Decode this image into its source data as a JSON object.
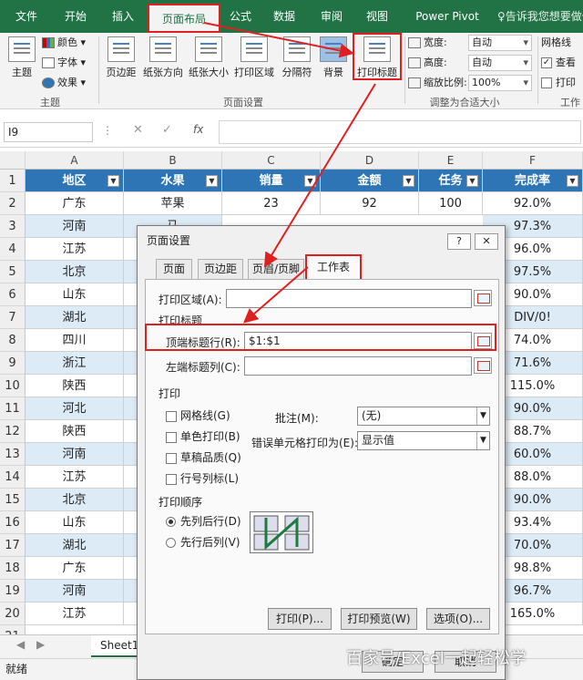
{
  "menu": {
    "tabs": [
      "文件",
      "开始",
      "插入",
      "页面布局",
      "公式",
      "数据",
      "审阅",
      "视图",
      "Power Pivot"
    ],
    "tellme": "告诉我您想要做什"
  },
  "ribbon": {
    "theme_group": {
      "label": "主题",
      "main": "主题",
      "colors": "颜色",
      "fonts": "字体",
      "effects": "效果"
    },
    "page_setup_group": {
      "label": "页面设置",
      "margins": "页边距",
      "orientation": "纸张方向",
      "size": "纸张大小",
      "print_area": "打印区域",
      "breaks": "分隔符",
      "background": "背景",
      "print_titles": "打印标题"
    },
    "scale_group": {
      "label": "调整为合适大小",
      "width_label": "宽度:",
      "width_value": "自动",
      "height_label": "高度:",
      "height_value": "自动",
      "scale_label": "缩放比例:",
      "scale_value": "100%"
    },
    "sheet_options": {
      "label": "网格线",
      "view": "查看",
      "print": "打印",
      "tab": "工作"
    }
  },
  "formula_bar": {
    "name_box": "I9",
    "fx": "fx"
  },
  "grid": {
    "columns": [
      "A",
      "B",
      "C",
      "D",
      "E",
      "F"
    ],
    "rows": [
      "1",
      "2",
      "3",
      "4",
      "5",
      "6",
      "7",
      "8",
      "9",
      "10",
      "11",
      "12",
      "13",
      "14",
      "15",
      "16",
      "17",
      "18",
      "19",
      "20",
      "21"
    ],
    "header": [
      "地区",
      "水果",
      "销量",
      "金额",
      "任务",
      "完成率"
    ],
    "first_row": [
      "广东",
      "苹果",
      "23",
      "92",
      "100",
      "92.0%"
    ],
    "col_a": [
      "河南",
      "江苏",
      "北京",
      "山东",
      "湖北",
      "四川",
      "浙江",
      "陕西",
      "河北",
      "陕西",
      "河南",
      "江苏",
      "北京",
      "山东",
      "湖北",
      "广东",
      "河南",
      "江苏"
    ],
    "col_b_partial": "马",
    "col_f_partial": [
      "97.3%",
      "96.0%",
      "97.5%",
      "90.0%",
      "DIV/0!",
      "74.0%",
      "71.6%",
      "115.0%",
      "90.0%",
      "88.7%",
      "60.0%",
      "88.0%",
      "90.0%",
      "93.4%",
      "70.0%",
      "98.8%",
      "96.7%",
      "165.0%"
    ]
  },
  "dialog": {
    "title": "页面设置",
    "help": "?",
    "close": "✕",
    "tabs": [
      "页面",
      "页边距",
      "页眉/页脚",
      "工作表"
    ],
    "print_area_label": "打印区域(A):",
    "print_titles_section": "打印标题",
    "rows_repeat_label": "顶端标题行(R):",
    "rows_repeat_value": "$1:$1",
    "cols_repeat_label": "左端标题列(C):",
    "print_section": "打印",
    "gridlines": "网格线(G)",
    "black_white": "单色打印(B)",
    "draft": "草稿品质(Q)",
    "row_col_headings": "行号列标(L)",
    "comments_label": "批注(M):",
    "comments_value": "(无)",
    "errors_label": "错误单元格打印为(E):",
    "errors_value": "显示值",
    "page_order_section": "打印顺序",
    "down_then_over": "先列后行(D)",
    "over_then_down": "先行后列(V)",
    "btn_print": "打印(P)...",
    "btn_preview": "打印预览(W)",
    "btn_options": "选项(O)...",
    "btn_ok": "确定",
    "btn_cancel": "取消"
  },
  "sheet_tab": "Sheet1",
  "status": "就绪",
  "watermark": "百家号/Excel一起轻松学"
}
